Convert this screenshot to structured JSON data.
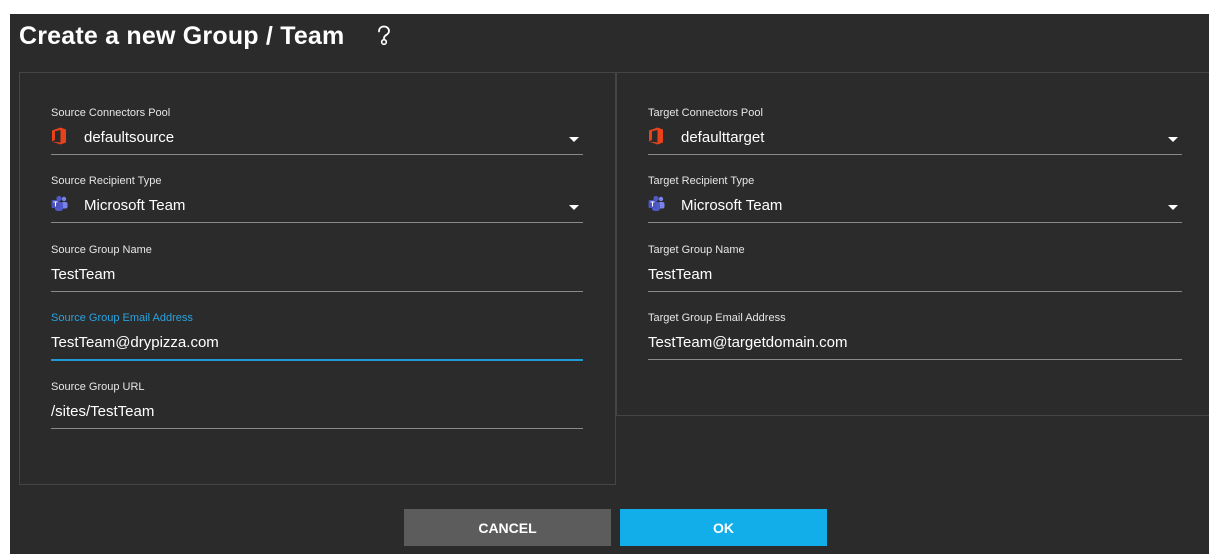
{
  "dialog": {
    "title": "Create a new Group / Team"
  },
  "source": {
    "pool": {
      "label": "Source Connectors Pool",
      "value": "defaultsource",
      "icon": "office-icon"
    },
    "recipient_type": {
      "label": "Source Recipient Type",
      "value": "Microsoft Team",
      "icon": "teams-icon"
    },
    "group_name": {
      "label": "Source Group Name",
      "value": "TestTeam"
    },
    "email": {
      "label": "Source Group Email Address",
      "value": "TestTeam@drypizza.com"
    },
    "url": {
      "label": "Source Group URL",
      "value": "/sites/TestTeam"
    }
  },
  "target": {
    "pool": {
      "label": "Target Connectors Pool",
      "value": "defaulttarget",
      "icon": "office-icon"
    },
    "recipient_type": {
      "label": "Target Recipient Type",
      "value": "Microsoft Team",
      "icon": "teams-icon"
    },
    "group_name": {
      "label": "Target Group Name",
      "value": "TestTeam"
    },
    "email": {
      "label": "Target Group Email Address",
      "value": "TestTeam@targetdomain.com"
    }
  },
  "buttons": {
    "cancel": "CANCEL",
    "ok": "OK"
  },
  "colors": {
    "background": "#2b2b2b",
    "accent": "#12aeea",
    "focus_line": "#1f9ad6",
    "cancel_button": "#5c5c5c",
    "office_icon": "#e8421b",
    "teams_icon": "#7b83eb"
  }
}
